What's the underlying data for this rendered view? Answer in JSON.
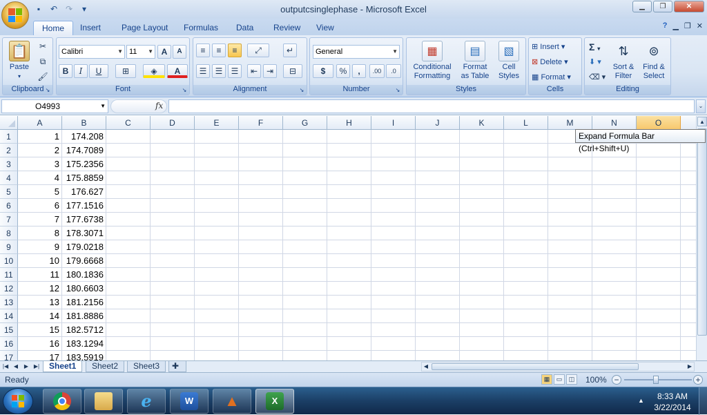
{
  "window": {
    "title": "outputcsinglephase - Microsoft Excel"
  },
  "quick_access": {
    "save_icon": "save-icon",
    "undo_icon": "undo-icon",
    "redo_icon": "redo-icon",
    "customize_icon": "customize-qat-icon"
  },
  "ribbon_tabs": [
    "Home",
    "Insert",
    "Page Layout",
    "Formulas",
    "Data",
    "Review",
    "View"
  ],
  "active_tab": "Home",
  "ribbon": {
    "clipboard": {
      "paste": "Paste",
      "label": "Clipboard"
    },
    "font": {
      "name": "Calibri",
      "size": "11",
      "label": "Font",
      "bold": "B",
      "italic": "I",
      "underline": "U",
      "grow": "A",
      "shrink": "A",
      "font_color": "A"
    },
    "alignment": {
      "label": "Alignment"
    },
    "number": {
      "format": "General",
      "label": "Number",
      "currency": "$",
      "percent": "%",
      "comma": ",",
      "inc_decimal": ".00",
      "dec_decimal": ".0"
    },
    "styles": {
      "label": "Styles",
      "conditional": [
        "Conditional",
        "Formatting"
      ],
      "format_table": [
        "Format",
        "as Table"
      ],
      "cell_styles": [
        "Cell",
        "Styles"
      ]
    },
    "cells": {
      "label": "Cells",
      "insert": "Insert",
      "delete": "Delete",
      "format": "Format"
    },
    "editing": {
      "label": "Editing",
      "sort": [
        "Sort &",
        "Filter"
      ],
      "find": [
        "Find &",
        "Select"
      ],
      "sum": "Σ"
    }
  },
  "formula_bar": {
    "name_box": "O4993",
    "fx": "fx",
    "value": "",
    "tooltip": "Expand Formula Bar (Ctrl+Shift+U)"
  },
  "columns": [
    "A",
    "B",
    "C",
    "D",
    "E",
    "F",
    "G",
    "H",
    "I",
    "J",
    "K",
    "L",
    "M",
    "N",
    "O"
  ],
  "selected_column": "O",
  "rows": [
    {
      "n": "1",
      "a": "1",
      "b": "174.208"
    },
    {
      "n": "2",
      "a": "2",
      "b": "174.7089"
    },
    {
      "n": "3",
      "a": "3",
      "b": "175.2356"
    },
    {
      "n": "4",
      "a": "4",
      "b": "175.8859"
    },
    {
      "n": "5",
      "a": "5",
      "b": "176.627"
    },
    {
      "n": "6",
      "a": "6",
      "b": "177.1516"
    },
    {
      "n": "7",
      "a": "7",
      "b": "177.6738"
    },
    {
      "n": "8",
      "a": "8",
      "b": "178.3071"
    },
    {
      "n": "9",
      "a": "9",
      "b": "179.0218"
    },
    {
      "n": "10",
      "a": "10",
      "b": "179.6668"
    },
    {
      "n": "11",
      "a": "11",
      "b": "180.1836"
    },
    {
      "n": "12",
      "a": "12",
      "b": "180.6603"
    },
    {
      "n": "13",
      "a": "13",
      "b": "181.2156"
    },
    {
      "n": "14",
      "a": "14",
      "b": "181.8886"
    },
    {
      "n": "15",
      "a": "15",
      "b": "182.5712"
    },
    {
      "n": "16",
      "a": "16",
      "b": "183.1294"
    },
    {
      "n": "17",
      "a": "17",
      "b": "183.5919"
    }
  ],
  "sheets": [
    "Sheet1",
    "Sheet2",
    "Sheet3"
  ],
  "active_sheet": "Sheet1",
  "status": {
    "ready": "Ready",
    "zoom": "100%"
  },
  "taskbar": {
    "apps": [
      "chrome-icon",
      "file-explorer-icon",
      "internet-explorer-icon",
      "word-icon",
      "matlab-icon",
      "excel-icon"
    ],
    "time": "8:33 AM",
    "date": "3/22/2014"
  },
  "colors": {
    "accent": "#15428b",
    "ribbon_bg": "#dae6f4",
    "selected_header": "#f7c86e"
  }
}
